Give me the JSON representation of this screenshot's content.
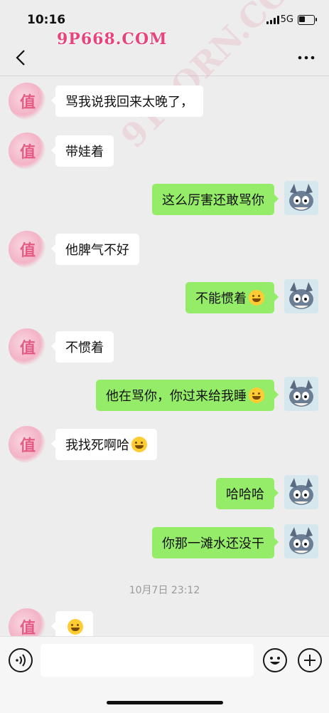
{
  "status_bar": {
    "time": "10:16",
    "network": "5G",
    "battery_level": 0.4
  },
  "watermarks": {
    "top": "9P668.COM",
    "diagonal": "91PORN.COM"
  },
  "messages": [
    {
      "side": "in",
      "text": "骂我说我回来太晚了，",
      "emoji": ""
    },
    {
      "side": "in",
      "text": "带娃着",
      "emoji": ""
    },
    {
      "side": "out",
      "text": "这么厉害还敢骂你",
      "emoji": ""
    },
    {
      "side": "in",
      "text": "他脾气不好",
      "emoji": ""
    },
    {
      "side": "out",
      "text": "不能惯着",
      "emoji": "laughing-tears-emoji"
    },
    {
      "side": "in",
      "text": "不惯着",
      "emoji": ""
    },
    {
      "side": "out",
      "text": "他在骂你，你过来给我睡",
      "emoji": "grinning-emoji"
    },
    {
      "side": "in",
      "text": "我找死啊哈",
      "emoji": "laughing-tears-emoji"
    },
    {
      "side": "out",
      "text": "哈哈哈",
      "emoji": ""
    },
    {
      "side": "out",
      "text": "你那一滩水还没干",
      "emoji": ""
    },
    {
      "side": "in",
      "text": "",
      "emoji": "thinking-emoji"
    }
  ],
  "timestamp": "10月7日 23:12",
  "colors": {
    "outgoing_bubble": "#95ec69",
    "incoming_bubble": "#ffffff",
    "background": "#ededed",
    "watermark": "#e8447a"
  },
  "icons": {
    "back": "chevron-left-icon",
    "more": "more-dots-icon",
    "voice": "voice-icon",
    "emoji": "smiley-icon",
    "plus": "plus-icon"
  },
  "input": {
    "value": "",
    "placeholder": ""
  }
}
